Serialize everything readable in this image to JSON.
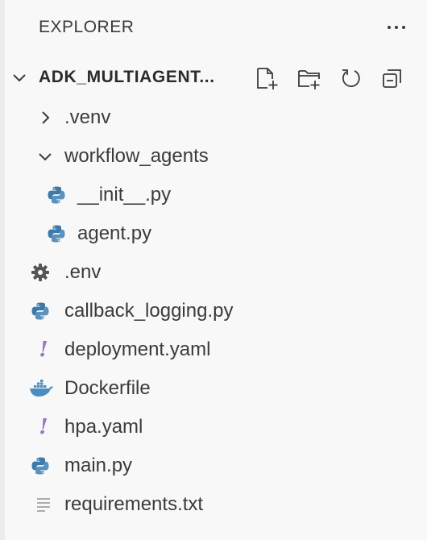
{
  "explorer": {
    "title": "EXPLORER",
    "more_icon": "ellipsis-icon"
  },
  "workspace": {
    "name": "ADK_MULTIAGENT...",
    "expanded": true,
    "actions": [
      {
        "name": "new-file-icon"
      },
      {
        "name": "new-folder-icon"
      },
      {
        "name": "refresh-icon"
      },
      {
        "name": "collapse-all-icon"
      }
    ]
  },
  "tree": [
    {
      "label": ".venv",
      "type": "folder",
      "expanded": false,
      "depth": 1,
      "icon": "chevron-right-icon"
    },
    {
      "label": "workflow_agents",
      "type": "folder",
      "expanded": true,
      "depth": 1,
      "icon": "chevron-down-icon"
    },
    {
      "label": "__init__.py",
      "type": "file",
      "depth": 2,
      "icon": "python-icon"
    },
    {
      "label": "agent.py",
      "type": "file",
      "depth": 2,
      "icon": "python-icon"
    },
    {
      "label": ".env",
      "type": "file",
      "depth": 1,
      "icon": "gear-icon"
    },
    {
      "label": "callback_logging.py",
      "type": "file",
      "depth": 1,
      "icon": "python-icon"
    },
    {
      "label": "deployment.yaml",
      "type": "file",
      "depth": 1,
      "icon": "yaml-icon"
    },
    {
      "label": "Dockerfile",
      "type": "file",
      "depth": 1,
      "icon": "docker-icon"
    },
    {
      "label": "hpa.yaml",
      "type": "file",
      "depth": 1,
      "icon": "yaml-icon"
    },
    {
      "label": "main.py",
      "type": "file",
      "depth": 1,
      "icon": "python-icon"
    },
    {
      "label": "requirements.txt",
      "type": "file",
      "depth": 1,
      "icon": "text-file-icon"
    }
  ],
  "colors": {
    "background": "#f8f8f8",
    "text": "#3b3b3b",
    "python_blue": "#3d7aab",
    "python_yellow": "#ffd43b",
    "yaml_purple": "#a074c4",
    "docker_blue": "#4a8ec0"
  }
}
